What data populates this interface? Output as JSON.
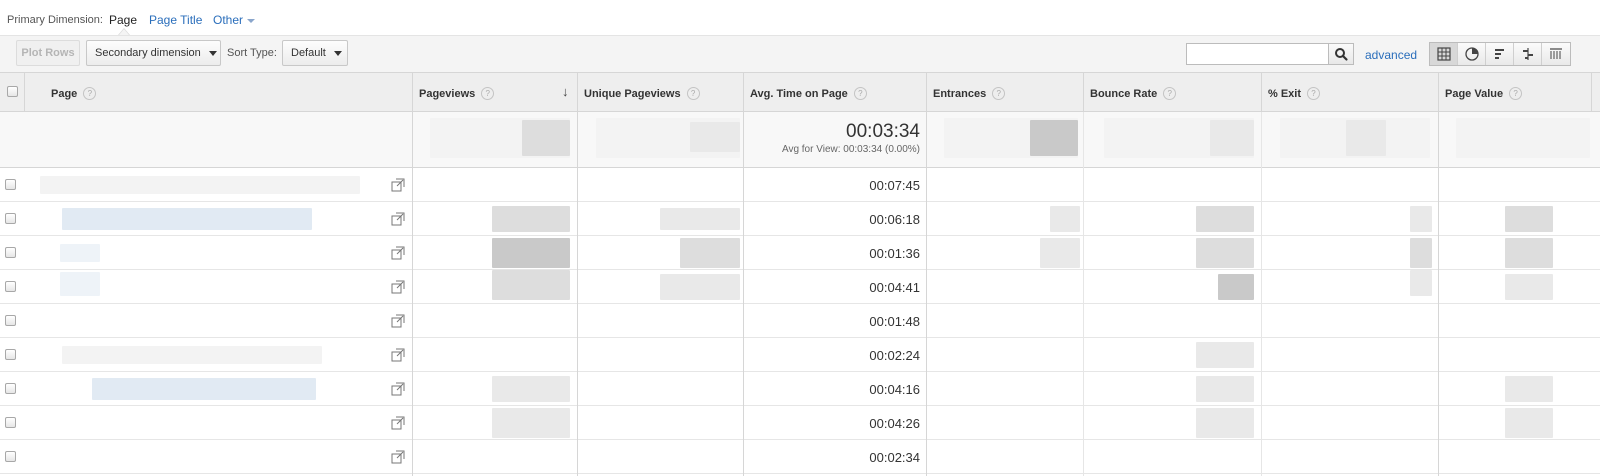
{
  "primary_dimension": {
    "label": "Primary Dimension:",
    "active": "Page",
    "options": [
      "Page Title",
      "Other"
    ]
  },
  "toolbar": {
    "plot_rows": "Plot Rows",
    "secondary_dimension": "Secondary dimension",
    "sort_type_label": "Sort Type:",
    "sort_type_value": "Default",
    "search_value": "",
    "advanced": "advanced",
    "view_icons": [
      "grid-view-icon",
      "pie-view-icon",
      "bar-view-icon",
      "comparison-view-icon",
      "pivot-view-icon"
    ]
  },
  "table": {
    "columns": [
      "Page",
      "Pageviews",
      "Unique Pageviews",
      "Avg. Time on Page",
      "Entrances",
      "Bounce Rate",
      "% Exit",
      "Page Value"
    ],
    "sorted_column": "Pageviews",
    "summary": {
      "avg_time": "00:03:34",
      "avg_for_view": "Avg for View: 00:03:34 (0.00%)"
    },
    "rows": [
      {
        "avg_time": "00:07:45"
      },
      {
        "avg_time": "00:06:18"
      },
      {
        "avg_time": "00:01:36"
      },
      {
        "avg_time": "00:04:41"
      },
      {
        "avg_time": "00:01:48"
      },
      {
        "avg_time": "00:02:24"
      },
      {
        "avg_time": "00:04:16"
      },
      {
        "avg_time": "00:04:26"
      },
      {
        "avg_time": "00:02:34"
      }
    ]
  },
  "colors": {
    "link": "#2a6ebb",
    "header_bg": "#eeeeee",
    "toolbar_bg": "#f4f4f4"
  }
}
